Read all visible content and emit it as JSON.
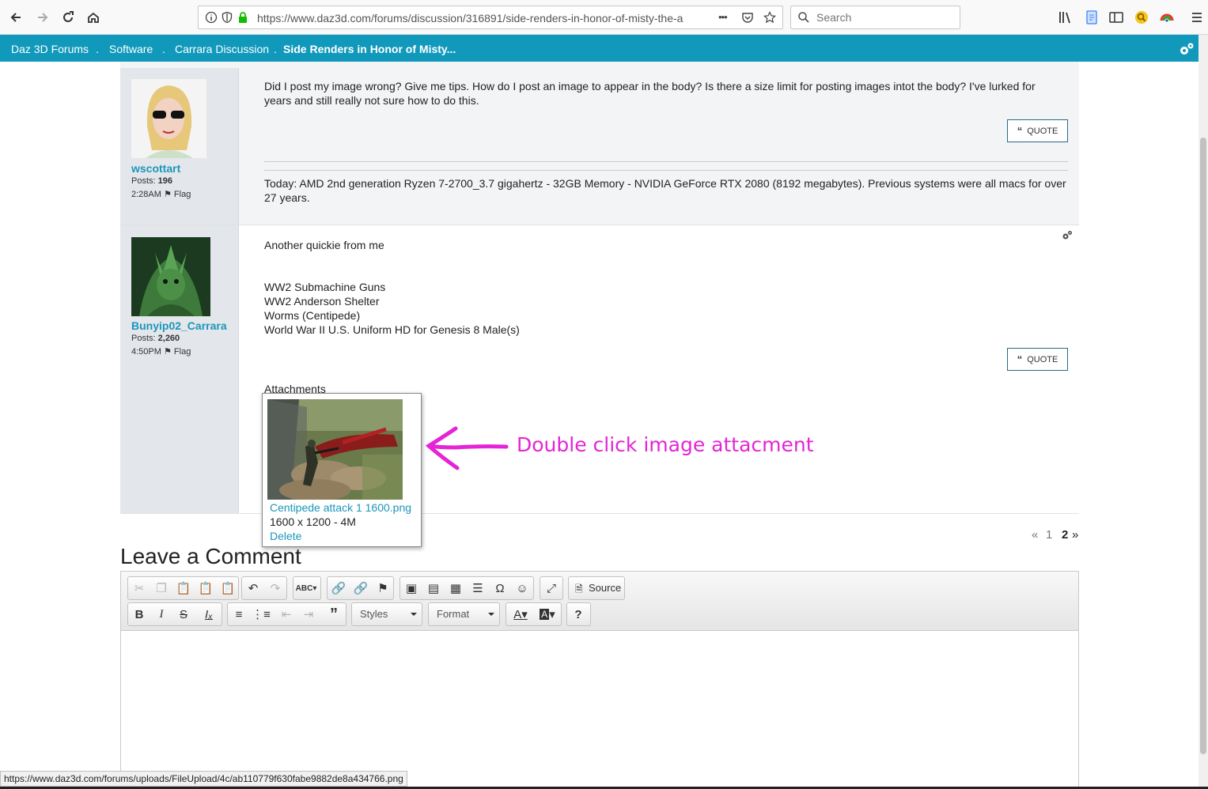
{
  "browser": {
    "url": "https://www.daz3d.com/forums/discussion/316891/side-renders-in-honor-of-misty-the-a",
    "search_placeholder": "Search",
    "more_label": "•••"
  },
  "breadcrumb": {
    "items": [
      "Daz 3D Forums",
      "Software",
      "Carrara Discussion",
      "Side Renders in Honor of Misty..."
    ],
    "separator": "."
  },
  "posts": [
    {
      "username": "wscottart",
      "posts_label": "Posts:",
      "posts_count": "196",
      "time": "2:28AM",
      "flag_label": "Flag",
      "body": "Did I post my image wrong? Give me tips. How do I post an image to appear in the body? Is there a size limit for posting images intot the body? I've lurked for years and still really not sure how to do this.",
      "quote_label": "QUOTE",
      "signature": "Today: AMD 2nd generation Ryzen 7-2700_3.7 gigahertz - 32GB Memory - NVIDIA GeForce RTX 2080 (8192 megabytes).  Previous systems were all macs for over 27 years."
    },
    {
      "username": "Bunyip02_Carrara",
      "posts_label": "Posts:",
      "posts_count": "2,260",
      "time": "4:50PM",
      "flag_label": "Flag",
      "intro": "Another quickie from me",
      "lines": [
        "WW2 Submachine Guns",
        "WW2 Anderson Shelter",
        "Worms (Centipede)",
        "World War II U.S. Uniform HD for Genesis 8 Male(s)"
      ],
      "quote_label": "QUOTE",
      "attachments_label": "Attachments"
    }
  ],
  "attachment": {
    "filename": "Centipede attack 1 1600.png",
    "info": "1600 x 1200 - 4M",
    "delete_label": "Delete"
  },
  "annotation": {
    "text": "Double click image attacment",
    "color": "#e424d6"
  },
  "pager": {
    "prev": "«",
    "page1": "1",
    "page2": "2",
    "next": "»"
  },
  "comment": {
    "title": "Leave a Comment",
    "source_label": "Source",
    "styles_label": "Styles",
    "format_label": "Format"
  },
  "status_url": "https://www.daz3d.com/forums/uploads/FileUpload/4c/ab110779f630fabe9882de8a434766.png",
  "colors": {
    "brand": "#1199bb",
    "link": "#1a96bb",
    "sidebar": "#e3e6ea"
  }
}
